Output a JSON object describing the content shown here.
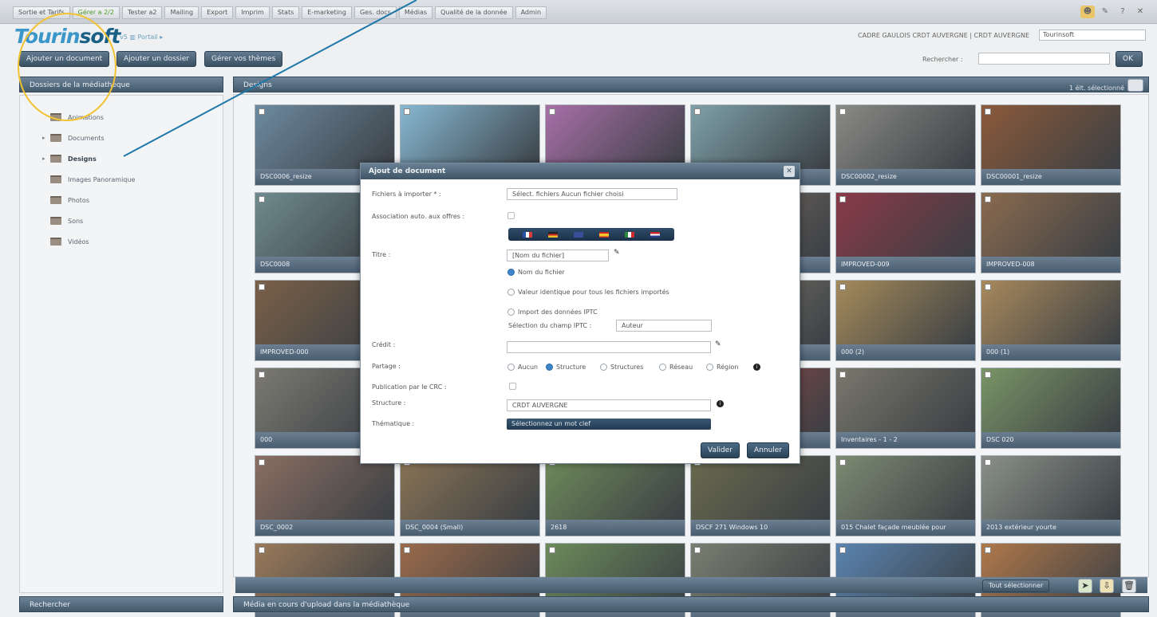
{
  "top_menu": {
    "items": [
      "Sortie et Tarifs",
      "Gérer a 2/2",
      "Tester a2",
      "Mailing",
      "Export",
      "Imprim",
      "Stats",
      "E-marketing",
      "Ges. docs",
      "Médias",
      "Qualité de la donnée",
      "Admin"
    ]
  },
  "header": {
    "logo_part1": "Tourin",
    "logo_part2": "soft",
    "logo_sub": "v5 ▥ Portail ▸",
    "account": "CADRE GAULOIS CRDT AUVERGNE | CRDT AUVERGNE",
    "account_select": "Tourinsoft"
  },
  "toolbar": {
    "add_document": "Ajouter un document",
    "add_folder": "Ajouter un dossier",
    "my_themes": "Gérer vos thèmes",
    "search_label": "Rechercher :",
    "ok_label": "OK"
  },
  "left_panel": {
    "title": "Dossiers de la médiathèque",
    "folders": [
      {
        "label": "Animations",
        "expandable": false,
        "bold": false
      },
      {
        "label": "Documents",
        "expandable": true,
        "bold": false
      },
      {
        "label": "Designs",
        "expandable": true,
        "bold": true
      },
      {
        "label": "Images Panoramique",
        "expandable": false,
        "bold": false
      },
      {
        "label": "Photos",
        "expandable": false,
        "bold": false
      },
      {
        "label": "Sons",
        "expandable": false,
        "bold": false
      },
      {
        "label": "Vidéos",
        "expandable": false,
        "bold": false
      }
    ],
    "footer": "Rechercher"
  },
  "main": {
    "title": "Designs",
    "selection_count": "1 élt. sélectionné",
    "tiles": [
      {
        "caption": "DSC0006_resize",
        "color": "#6d8aa0"
      },
      {
        "caption": "",
        "color": "#87b8d2"
      },
      {
        "caption": "",
        "color": "#a86fa8"
      },
      {
        "caption": "",
        "color": "#7ea0a8"
      },
      {
        "caption": "DSC00002_resize",
        "color": "#8a8a86"
      },
      {
        "caption": "DSC00001_resize",
        "color": "#8b5a3a"
      },
      {
        "caption": "DSC0008",
        "color": "#6f8b8e"
      },
      {
        "caption": "",
        "color": "#8a9070"
      },
      {
        "caption": "",
        "color": "#8a7a68"
      },
      {
        "caption": "",
        "color": "#7e7066"
      },
      {
        "caption": "IMPROVED-009",
        "color": "#8a3a48"
      },
      {
        "caption": "IMPROVED-008",
        "color": "#8a6a4e"
      },
      {
        "caption": "IMPROVED-000",
        "color": "#7a6048"
      },
      {
        "caption": "",
        "color": "#6e6a60"
      },
      {
        "caption": "",
        "color": "#8d8c8a"
      },
      {
        "caption": "",
        "color": "#837b70"
      },
      {
        "caption": "000 (2)",
        "color": "#a48a5a"
      },
      {
        "caption": "000 (1)",
        "color": "#a8895c"
      },
      {
        "caption": "000",
        "color": "#7c7a72"
      },
      {
        "caption": "",
        "color": "#6e8064"
      },
      {
        "caption": "",
        "color": "#7a7c74"
      },
      {
        "caption": "",
        "color": "#9a4a48"
      },
      {
        "caption": "Inventaires - 1 - 2",
        "color": "#7a776c"
      },
      {
        "caption": "DSC 020",
        "color": "#7a9466"
      },
      {
        "caption": "DSC_0002",
        "color": "#8a6e62"
      },
      {
        "caption": "DSC_0004 (Small)",
        "color": "#8a7456"
      },
      {
        "caption": "2618",
        "color": "#6f8a5a"
      },
      {
        "caption": "DSCF 271 Windows 10",
        "color": "#6a6a4e"
      },
      {
        "caption": "015 Chalet façade meublée pour",
        "color": "#7c8a72"
      },
      {
        "caption": "2013 extérieur yourte",
        "color": "#8a9088"
      },
      {
        "caption": "",
        "color": "#9a7a5a"
      },
      {
        "caption": "",
        "color": "#9a6a4a"
      },
      {
        "caption": "",
        "color": "#6c8a5a"
      },
      {
        "caption": "",
        "color": "#7a7e70"
      },
      {
        "caption": "",
        "color": "#5a84b0"
      },
      {
        "caption": "",
        "color": "#b0784a"
      }
    ],
    "select_all": "Tout sélectionner",
    "footer": "Média en cours d'upload dans la médiathèque"
  },
  "modal": {
    "title": "Ajout de document",
    "close": "✕",
    "files_label": "Fichiers à importer * :",
    "files_value": "Sélect. fichiers   Aucun fichier choisi",
    "assoc_label": "Association auto. aux offres :",
    "title_label": "Titre :",
    "title_value": "[Nom du fichier]",
    "opt_filename": "Nom du fichier",
    "opt_identical": "Valeur identique pour tous les fichiers importés",
    "opt_iptc": "Import des données IPTC",
    "iptc_field_label": "Sélection du champ IPTC :",
    "iptc_field_value": "Auteur",
    "credit_label": "Crédit :",
    "sharing_label": "Partage :",
    "sharing_options": [
      "Aucun",
      "Structure",
      "Structures",
      "Réseau",
      "Région"
    ],
    "publication_label": "Publication par le CRC :",
    "structure_label": "Structure :",
    "structure_value": "CRDT AUVERGNE",
    "themes_label": "Thématique :",
    "themes_value": "Sélectionnez un mot clef",
    "validate": "Valider",
    "cancel": "Annuler"
  },
  "colors": {
    "accent": "#3b97c9",
    "highlight_circle": "#f1c232",
    "pointer_line": "#1f78a8"
  }
}
